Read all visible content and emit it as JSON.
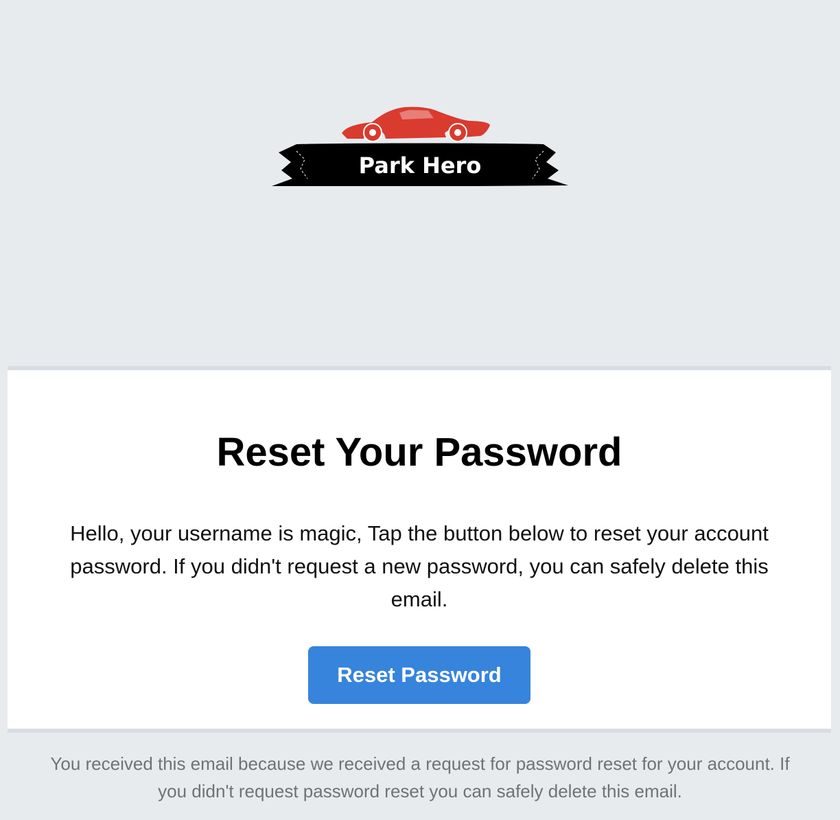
{
  "logo": {
    "brand_text": "Park Hero",
    "car_color": "#d93b2f",
    "ribbon_color": "#000000"
  },
  "card": {
    "title": "Reset Your Password",
    "message": "Hello, your username is magic, Tap the button below to reset your account password. If you didn't request a new password, you can safely delete this email.",
    "button_label": "Reset Password",
    "button_color": "#3784dc"
  },
  "footer": {
    "text": "You received this email because we received a request for password reset for your account. If you didn't request password reset you can safely delete this email."
  }
}
